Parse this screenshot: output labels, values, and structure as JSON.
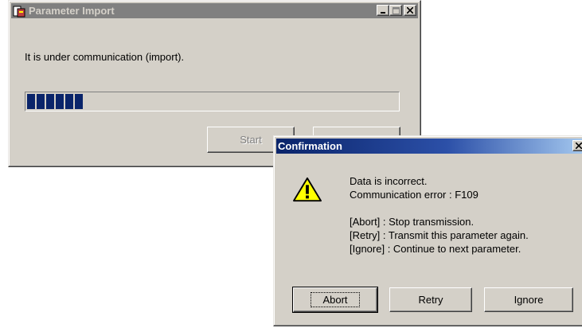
{
  "import_window": {
    "title": "Parameter Import",
    "status_text": "It is under communication (import).",
    "progress_blocks": 6,
    "start_label": "Start"
  },
  "confirm_dialog": {
    "title": "Confirmation",
    "lines": [
      "Data is incorrect.",
      "Communication error : F109",
      "",
      "[Abort] : Stop transmission.",
      "[Retry] : Transmit this parameter again.",
      "[Ignore] : Continue to next parameter."
    ],
    "buttons": {
      "abort": "Abort",
      "retry": "Retry",
      "ignore": "Ignore"
    }
  },
  "colors": {
    "face": "#d4d0c8",
    "progress": "#0a246a",
    "active_title": "#0a246a",
    "inactive_title": "#808080"
  }
}
